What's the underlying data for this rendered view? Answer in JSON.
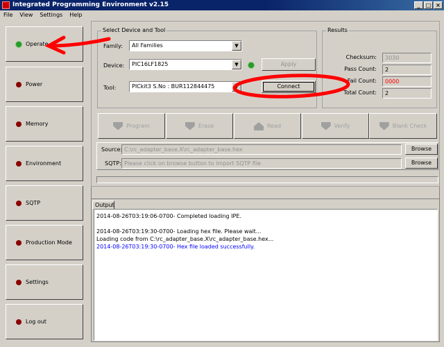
{
  "window": {
    "title": "Integrated Programming Environment v2.15"
  },
  "menu": [
    "File",
    "View",
    "Settings",
    "Help"
  ],
  "sidebar": [
    {
      "label": "Operate",
      "status": "green"
    },
    {
      "label": "Power"
    },
    {
      "label": "Memory"
    },
    {
      "label": "Environment"
    },
    {
      "label": "SQTP"
    },
    {
      "label": "Production Mode"
    },
    {
      "label": "Settings"
    },
    {
      "label": "Log out"
    }
  ],
  "device": {
    "group": "Select Device and Tool",
    "family_label": "Family:",
    "family": "All Families",
    "device_label": "Device:",
    "device": "PIC16LF1825",
    "tool_label": "Tool:",
    "tool": "PICkit3 S.No : BUR112844475",
    "apply": "Apply",
    "connect": "Connect"
  },
  "results": {
    "group": "Results",
    "checksum_label": "Checksum:",
    "checksum": "3030",
    "pass_label": "Pass Count:",
    "pass": "2",
    "fail_label": "Fail Count:",
    "fail": "0000",
    "total_label": "Total Count:",
    "total": "2"
  },
  "actions": [
    "Program",
    "Erase",
    "Read",
    "Verify",
    "Blank Check"
  ],
  "source": {
    "label": "Source:",
    "value": "C:\\rc_adapter_base.X\\rc_adapter_base.hex",
    "browse": "Browse"
  },
  "sqtp": {
    "label": "SQTP:",
    "placeholder": "Please click on browse button to import SQTP file",
    "browse": "Browse"
  },
  "output": {
    "tab": "Output",
    "lines": [
      "2014-08-26T03:19:06-0700- Completed loading IPE.",
      "",
      "2014-08-26T03:19:30-0700- Loading hex file. Please wait...",
      "Loading code from C:\\rc_adapter_base.X\\rc_adapter_base.hex...",
      "2014-08-26T03:19:30-0700- Hex file loaded successfully."
    ]
  },
  "colors": {
    "annotation": "#ff0000",
    "success_text": "#0000ff",
    "fail_text": "#ff0000"
  }
}
